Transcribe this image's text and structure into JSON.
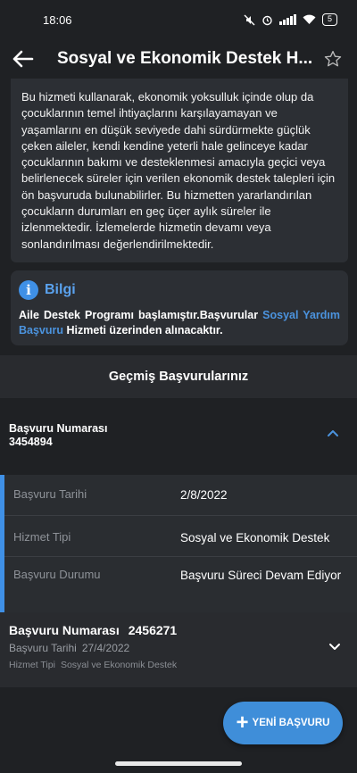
{
  "status": {
    "time": "18:06",
    "battery": "5"
  },
  "header": {
    "title": "Sosyal ve Ekonomik Destek H..."
  },
  "description": "Bu hizmeti kullanarak, ekonomik yoksulluk içinde olup da çocuklarının temel ihtiyaçlarını karşılayamayan ve yaşamlarını en düşük seviyede dahi sürdürmekte güçlük çeken aileler, kendi kendine yeterli hale gelinceye kadar çocuklarının bakımı ve desteklenmesi amacıyla geçici veya belirlenecek süreler için verilen ekonomik destek talepleri için ön başvuruda bulunabilirler. Bu hizmetten yararlandırılan çocukların durumları en geç üçer aylık süreler ile izlenmektedir. İzlemelerde hizmetin devamı veya sonlandırılması değerlendirilmektedir.",
  "info": {
    "icon": "info-icon",
    "title": "Bilgi",
    "text_before": "Aile Destek Programı başlamıştır.Başvurular ",
    "link": "Sosyal Yardım Başvuru",
    "text_after": " Hizmeti üzerinden alınacaktır."
  },
  "section_title": "Geçmiş Başvurularınız",
  "applications": [
    {
      "number_label": "Başvuru Numarası",
      "number": "3454894",
      "expanded": true,
      "details": [
        {
          "key": "Başvuru Tarihi",
          "value": "2/8/2022"
        },
        {
          "key": "Hizmet Tipi",
          "value": "Sosyal ve Ekonomik Destek"
        },
        {
          "key": "Başvuru Durumu",
          "value": "Başvuru Süreci Devam Ediyor"
        }
      ]
    },
    {
      "number_label": "Başvuru Numarası",
      "number": "2456271",
      "expanded": false,
      "date_label": "Başvuru Tarihi",
      "date": "27/4/2022",
      "type_label": "Hizmet Tipi",
      "type": "Sosyal ve Ekonomik Destek"
    }
  ],
  "fab": {
    "icon": "plus-icon",
    "label": "YENİ BAŞVURU"
  },
  "colors": {
    "background": "#1f2124",
    "card": "#2c2f34",
    "accent": "#3f90e6",
    "link": "#4b93de"
  }
}
